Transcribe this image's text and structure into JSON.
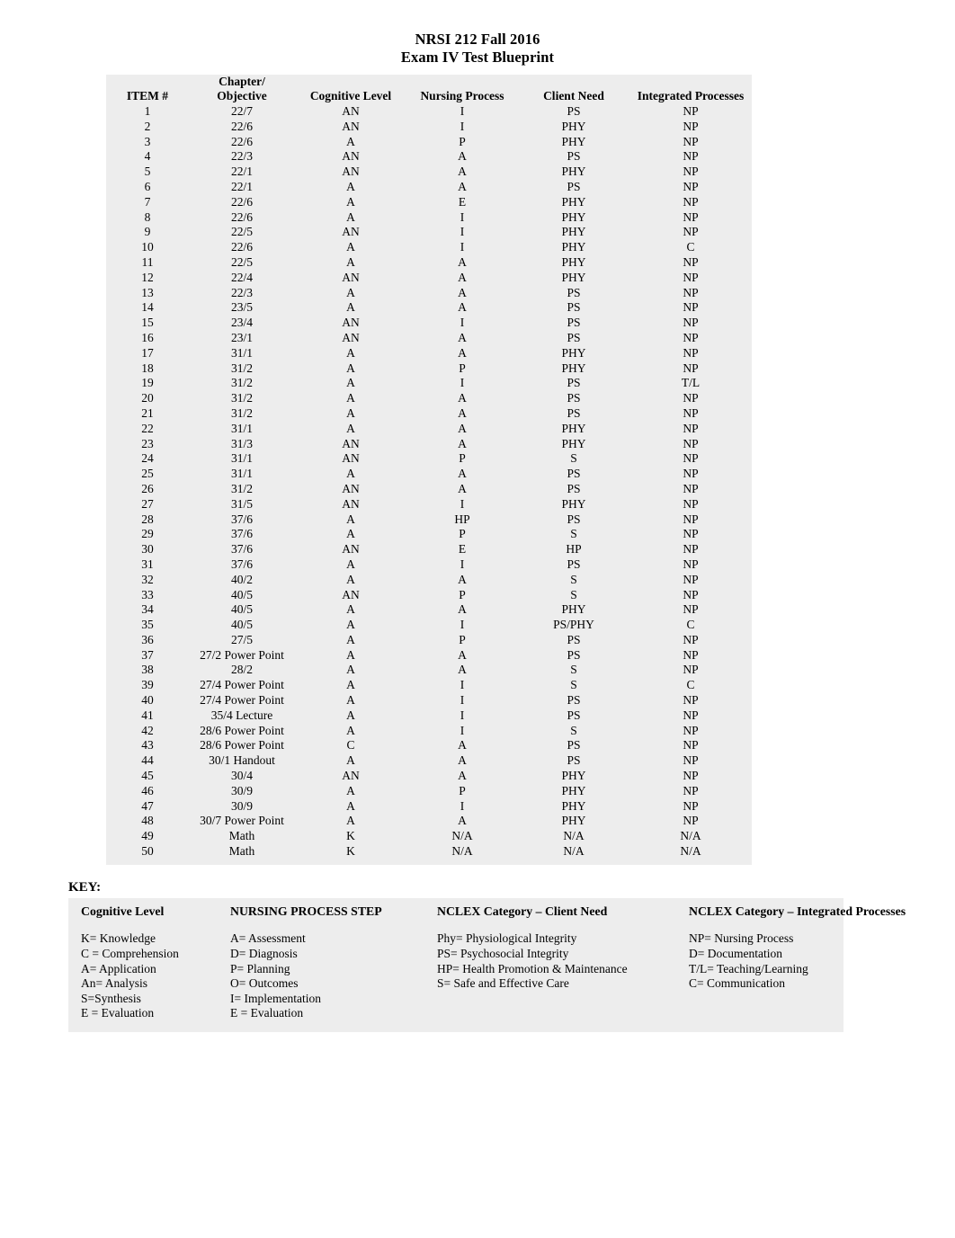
{
  "document": {
    "title_line1": "NRSI 212 Fall 2016",
    "title_line2": "Exam IV Test Blueprint"
  },
  "blueprint_table": {
    "headers": {
      "item": "ITEM #",
      "chapter_line1": "Chapter/",
      "chapter_line2": "Objective",
      "cognitive_level": "Cognitive Level",
      "nursing_process": "Nursing Process",
      "client_need": "Client Need",
      "integrated_processes": "Integrated Processes"
    },
    "rows": [
      {
        "item": "1",
        "chapter": "22/7",
        "cognitive": "AN",
        "nursing": "I",
        "need": "PS",
        "integrated": "NP"
      },
      {
        "item": "2",
        "chapter": "22/6",
        "cognitive": "AN",
        "nursing": "I",
        "need": "PHY",
        "integrated": "NP"
      },
      {
        "item": "3",
        "chapter": "22/6",
        "cognitive": "A",
        "nursing": "P",
        "need": "PHY",
        "integrated": "NP"
      },
      {
        "item": "4",
        "chapter": "22/3",
        "cognitive": "AN",
        "nursing": "A",
        "need": "PS",
        "integrated": "NP"
      },
      {
        "item": "5",
        "chapter": "22/1",
        "cognitive": "AN",
        "nursing": "A",
        "need": "PHY",
        "integrated": "NP"
      },
      {
        "item": "6",
        "chapter": "22/1",
        "cognitive": "A",
        "nursing": "A",
        "need": "PS",
        "integrated": "NP"
      },
      {
        "item": "7",
        "chapter": "22/6",
        "cognitive": "A",
        "nursing": "E",
        "need": "PHY",
        "integrated": "NP"
      },
      {
        "item": "8",
        "chapter": "22/6",
        "cognitive": "A",
        "nursing": "I",
        "need": "PHY",
        "integrated": "NP"
      },
      {
        "item": "9",
        "chapter": "22/5",
        "cognitive": "AN",
        "nursing": "I",
        "need": "PHY",
        "integrated": "NP"
      },
      {
        "item": "10",
        "chapter": "22/6",
        "cognitive": "A",
        "nursing": "I",
        "need": "PHY",
        "integrated": "C"
      },
      {
        "item": "11",
        "chapter": "22/5",
        "cognitive": "A",
        "nursing": "A",
        "need": "PHY",
        "integrated": "NP"
      },
      {
        "item": "12",
        "chapter": "22/4",
        "cognitive": "AN",
        "nursing": "A",
        "need": "PHY",
        "integrated": "NP"
      },
      {
        "item": "13",
        "chapter": "22/3",
        "cognitive": "A",
        "nursing": "A",
        "need": "PS",
        "integrated": "NP"
      },
      {
        "item": "14",
        "chapter": "23/5",
        "cognitive": "A",
        "nursing": "A",
        "need": "PS",
        "integrated": "NP"
      },
      {
        "item": "15",
        "chapter": "23/4",
        "cognitive": "AN",
        "nursing": "I",
        "need": "PS",
        "integrated": "NP"
      },
      {
        "item": "16",
        "chapter": "23/1",
        "cognitive": "AN",
        "nursing": "A",
        "need": "PS",
        "integrated": "NP"
      },
      {
        "item": "17",
        "chapter": "31/1",
        "cognitive": "A",
        "nursing": "A",
        "need": "PHY",
        "integrated": "NP"
      },
      {
        "item": "18",
        "chapter": "31/2",
        "cognitive": "A",
        "nursing": "P",
        "need": "PHY",
        "integrated": "NP"
      },
      {
        "item": "19",
        "chapter": "31/2",
        "cognitive": "A",
        "nursing": "I",
        "need": "PS",
        "integrated": "T/L"
      },
      {
        "item": "20",
        "chapter": "31/2",
        "cognitive": "A",
        "nursing": "A",
        "need": "PS",
        "integrated": "NP"
      },
      {
        "item": "21",
        "chapter": "31/2",
        "cognitive": "A",
        "nursing": "A",
        "need": "PS",
        "integrated": "NP"
      },
      {
        "item": "22",
        "chapter": "31/1",
        "cognitive": "A",
        "nursing": "A",
        "need": "PHY",
        "integrated": "NP"
      },
      {
        "item": "23",
        "chapter": "31/3",
        "cognitive": "AN",
        "nursing": "A",
        "need": "PHY",
        "integrated": "NP"
      },
      {
        "item": "24",
        "chapter": "31/1",
        "cognitive": "AN",
        "nursing": "P",
        "need": "S",
        "integrated": "NP"
      },
      {
        "item": "25",
        "chapter": "31/1",
        "cognitive": "A",
        "nursing": "A",
        "need": "PS",
        "integrated": "NP"
      },
      {
        "item": "26",
        "chapter": "31/2",
        "cognitive": "AN",
        "nursing": "A",
        "need": "PS",
        "integrated": "NP"
      },
      {
        "item": "27",
        "chapter": "31/5",
        "cognitive": "AN",
        "nursing": "I",
        "need": "PHY",
        "integrated": "NP"
      },
      {
        "item": "28",
        "chapter": "37/6",
        "cognitive": "A",
        "nursing": "HP",
        "need": "PS",
        "integrated": "NP"
      },
      {
        "item": "29",
        "chapter": "37/6",
        "cognitive": "A",
        "nursing": "P",
        "need": "S",
        "integrated": "NP"
      },
      {
        "item": "30",
        "chapter": "37/6",
        "cognitive": "AN",
        "nursing": "E",
        "need": "HP",
        "integrated": "NP"
      },
      {
        "item": "31",
        "chapter": "37/6",
        "cognitive": "A",
        "nursing": "I",
        "need": "PS",
        "integrated": "NP"
      },
      {
        "item": "32",
        "chapter": "40/2",
        "cognitive": "A",
        "nursing": "A",
        "need": "S",
        "integrated": "NP"
      },
      {
        "item": "33",
        "chapter": "40/5",
        "cognitive": "AN",
        "nursing": "P",
        "need": "S",
        "integrated": "NP"
      },
      {
        "item": "34",
        "chapter": "40/5",
        "cognitive": "A",
        "nursing": "A",
        "need": "PHY",
        "integrated": "NP"
      },
      {
        "item": "35",
        "chapter": "40/5",
        "cognitive": "A",
        "nursing": "I",
        "need": "PS/PHY",
        "integrated": "C"
      },
      {
        "item": "36",
        "chapter": "27/5",
        "cognitive": "A",
        "nursing": "P",
        "need": "PS",
        "integrated": "NP"
      },
      {
        "item": "37",
        "chapter": "27/2 Power Point",
        "cognitive": "A",
        "nursing": "A",
        "need": "PS",
        "integrated": "NP"
      },
      {
        "item": "38",
        "chapter": "28/2",
        "cognitive": "A",
        "nursing": "A",
        "need": "S",
        "integrated": "NP"
      },
      {
        "item": "39",
        "chapter": "27/4 Power Point",
        "cognitive": "A",
        "nursing": "I",
        "need": "S",
        "integrated": "C"
      },
      {
        "item": "40",
        "chapter": "27/4 Power Point",
        "cognitive": "A",
        "nursing": "I",
        "need": "PS",
        "integrated": "NP"
      },
      {
        "item": "41",
        "chapter": "35/4 Lecture",
        "cognitive": "A",
        "nursing": "I",
        "need": "PS",
        "integrated": "NP"
      },
      {
        "item": "42",
        "chapter": "28/6 Power Point",
        "cognitive": "A",
        "nursing": "I",
        "need": "S",
        "integrated": "NP"
      },
      {
        "item": "43",
        "chapter": "28/6 Power Point",
        "cognitive": "C",
        "nursing": "A",
        "need": "PS",
        "integrated": "NP"
      },
      {
        "item": "44",
        "chapter": "30/1 Handout",
        "cognitive": "A",
        "nursing": "A",
        "need": "PS",
        "integrated": "NP"
      },
      {
        "item": "45",
        "chapter": "30/4",
        "cognitive": "AN",
        "nursing": "A",
        "need": "PHY",
        "integrated": "NP"
      },
      {
        "item": "46",
        "chapter": "30/9",
        "cognitive": "A",
        "nursing": "P",
        "need": "PHY",
        "integrated": "NP"
      },
      {
        "item": "47",
        "chapter": "30/9",
        "cognitive": "A",
        "nursing": "I",
        "need": "PHY",
        "integrated": "NP"
      },
      {
        "item": "48",
        "chapter": "30/7 Power Point",
        "cognitive": "A",
        "nursing": "A",
        "need": "PHY",
        "integrated": "NP"
      },
      {
        "item": "49",
        "chapter": "Math",
        "cognitive": "K",
        "nursing": "N/A",
        "need": "N/A",
        "integrated": "N/A"
      },
      {
        "item": "50",
        "chapter": "Math",
        "cognitive": "K",
        "nursing": "N/A",
        "need": "N/A",
        "integrated": "N/A"
      }
    ]
  },
  "key": {
    "label": "KEY:",
    "columns": [
      {
        "heading": "Cognitive Level",
        "items": [
          "K= Knowledge",
          "C = Comprehension",
          "A= Application",
          "An= Analysis",
          "S=Synthesis",
          "E = Evaluation"
        ]
      },
      {
        "heading": "NURSING PROCESS STEP",
        "items": [
          "A= Assessment",
          "D= Diagnosis",
          "P= Planning",
          "O= Outcomes",
          "I= Implementation",
          "E = Evaluation"
        ]
      },
      {
        "heading": "NCLEX Category – Client Need",
        "items": [
          "Phy= Physiological Integrity",
          "PS= Psychosocial Integrity",
          "HP= Health Promotion & Maintenance",
          "S= Safe and Effective Care"
        ]
      },
      {
        "heading": "NCLEX Category – Integrated Processes",
        "items": [
          "NP= Nursing Process",
          "D= Documentation",
          "T/L= Teaching/Learning",
          "C= Communication"
        ]
      }
    ]
  }
}
